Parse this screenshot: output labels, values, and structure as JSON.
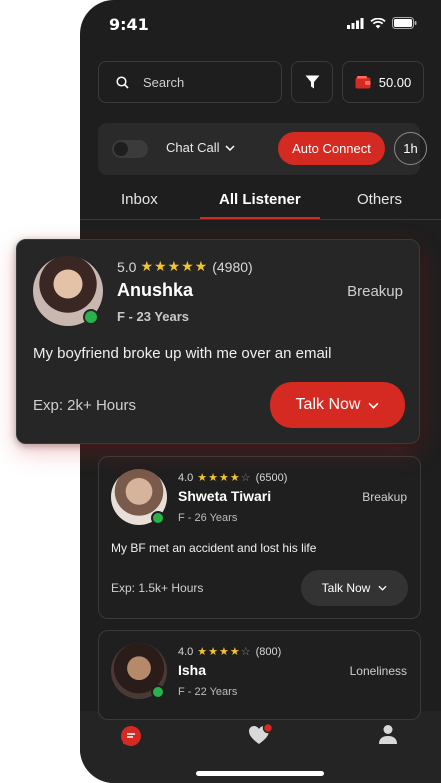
{
  "status": {
    "time": "9:41"
  },
  "search": {
    "placeholder": "Search"
  },
  "wallet": {
    "balance": "50.00"
  },
  "controls": {
    "mode_label": "Chat Call",
    "auto_connect_label": "Auto Connect",
    "duration": "1h",
    "toggle_on": false
  },
  "tabs": [
    {
      "label": "Inbox",
      "active": false
    },
    {
      "label": "All Listener",
      "active": true
    },
    {
      "label": "Others",
      "active": false
    }
  ],
  "listeners": [
    {
      "rating": "5.0",
      "stars": "★★★★★",
      "reviews": "(4980)",
      "name": "Anushka",
      "gender_age": "F - 23 Years",
      "topic": "Breakup",
      "message": "My boyfriend broke up with me over an email",
      "experience": "Exp: 2k+ Hours",
      "action": "Talk Now",
      "online": true
    },
    {
      "rating": "4.0",
      "stars": "★★★★",
      "empty_stars": "☆",
      "reviews": "(6500)",
      "name": "Shweta Tiwari",
      "gender_age": "F - 26 Years",
      "topic": "Breakup",
      "message": "My BF met an accident and lost his life",
      "experience": "Exp: 1.5k+ Hours",
      "action": "Talk Now",
      "online": true
    },
    {
      "rating": "4.0",
      "stars": "★★★★",
      "empty_stars": "☆",
      "reviews": "(800)",
      "name": "Isha",
      "gender_age": "F - 22 Years",
      "topic": "Loneliness",
      "online": true
    }
  ],
  "colors": {
    "accent": "#d42a22",
    "background": "#1e1e1e",
    "online": "#28b34a",
    "star": "#f4c430"
  },
  "nav": [
    {
      "icon": "chat-icon",
      "active": true
    },
    {
      "icon": "heart-notification-icon",
      "active": false
    },
    {
      "icon": "profile-icon",
      "active": false
    }
  ]
}
